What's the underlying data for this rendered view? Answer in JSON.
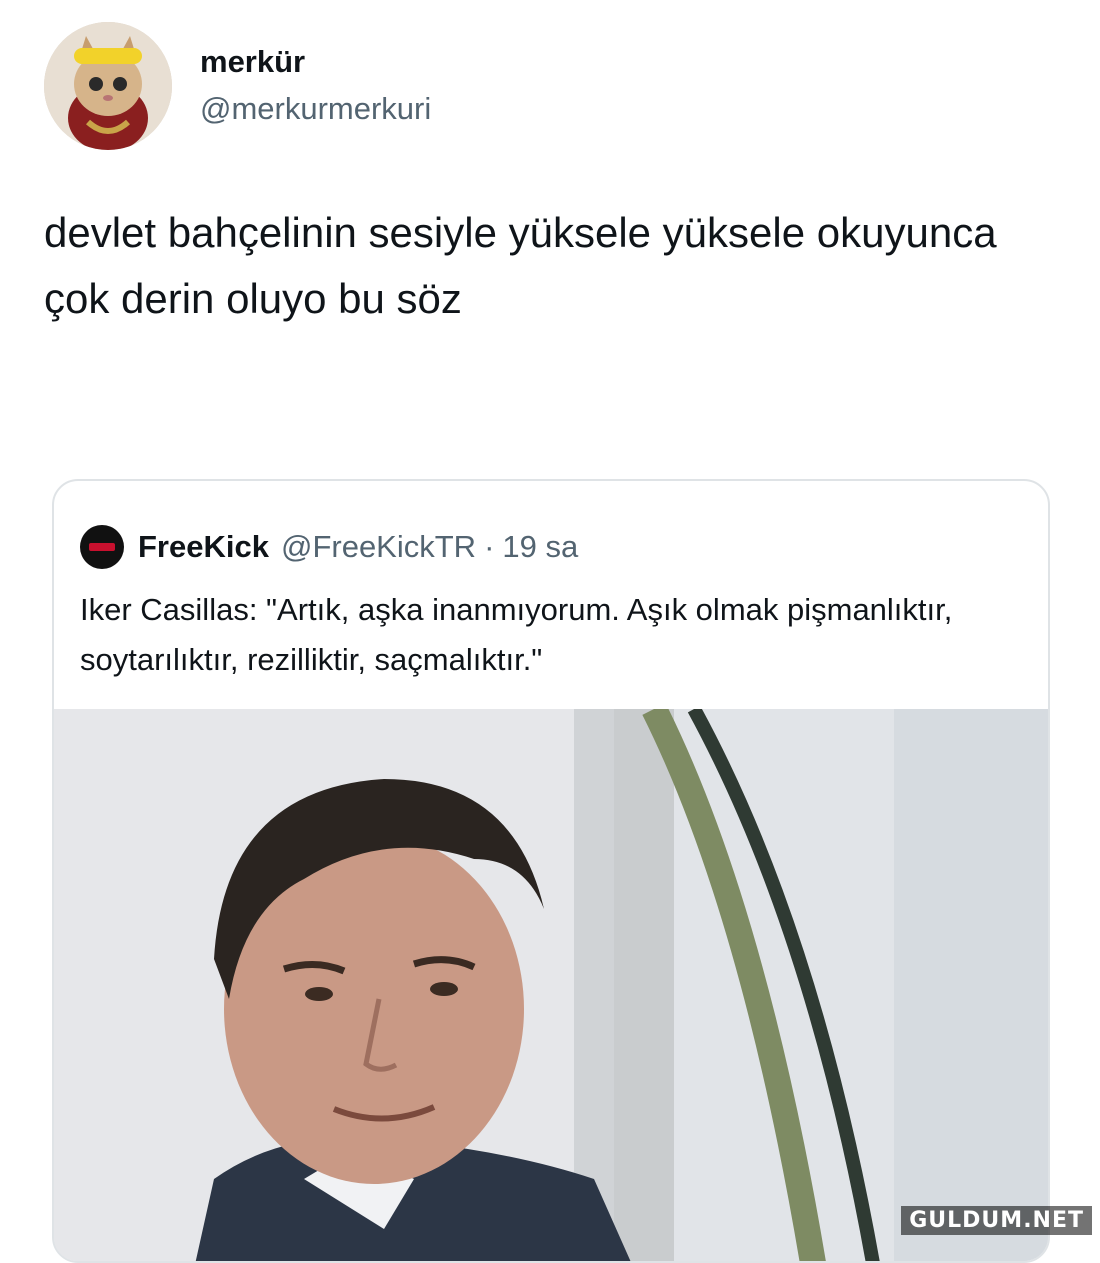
{
  "tweet": {
    "display_name": "merkür",
    "handle": "@merkurmerkuri",
    "avatar_icon": "kitten-avatar-icon",
    "text": "devlet bahçelinin sesiyle yüksele yüksele okuyunca çok derin oluyo bu söz"
  },
  "quote": {
    "avatar_icon": "freekick-logo-icon",
    "display_name": "FreeKick",
    "handle": "@FreeKickTR",
    "separator": "·",
    "time": "19 sa",
    "text": "Iker Casillas: \"Artık, aşka inanmıyorum. Aşık olmak pişmanlıktır, soytarılıktır, rezilliktir, saçmalıktır.\""
  },
  "watermark": "GULDUM.NET"
}
